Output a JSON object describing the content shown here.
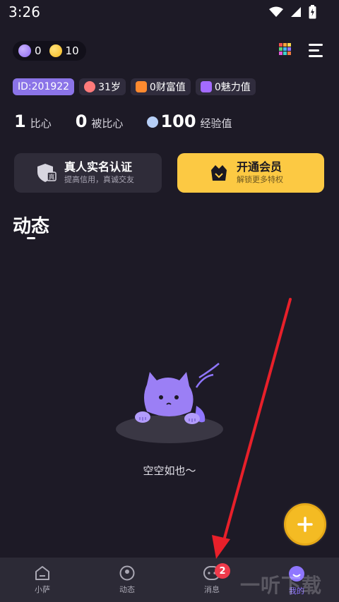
{
  "status_bar": {
    "time": "3:26"
  },
  "topbar": {
    "gems": "0",
    "coins": "10"
  },
  "tags": {
    "id": "ID:201922",
    "age": "31岁",
    "wealth": "0财富值",
    "charm": "0魅力值"
  },
  "stats": [
    {
      "value": "1",
      "label": "比心"
    },
    {
      "value": "0",
      "label": "被比心"
    },
    {
      "value": "100",
      "label": "经验值"
    }
  ],
  "cards": {
    "verify": {
      "title": "真人实名认证",
      "subtitle": "提高信用，真诚交友"
    },
    "vip": {
      "title": "开通会员",
      "subtitle": "解锁更多特权"
    }
  },
  "section": {
    "title": "动态"
  },
  "empty": {
    "text": "空空如也～"
  },
  "tabbar": {
    "tabs": [
      {
        "label": "小萨",
        "icon": "home-icon"
      },
      {
        "label": "动态",
        "icon": "feed-icon"
      },
      {
        "label": "消息",
        "icon": "message-icon",
        "badge": "2"
      },
      {
        "label": "我的",
        "icon": "profile-icon",
        "active": true
      }
    ]
  },
  "watermark": "一听下载",
  "colors": {
    "background": "#1d1a26",
    "accent_purple": "#8b74e8",
    "vip_yellow": "#fcc943",
    "fab_yellow": "#f4bb23",
    "badge_red": "#ef3a4b",
    "annotation_arrow": "#e8202a"
  }
}
